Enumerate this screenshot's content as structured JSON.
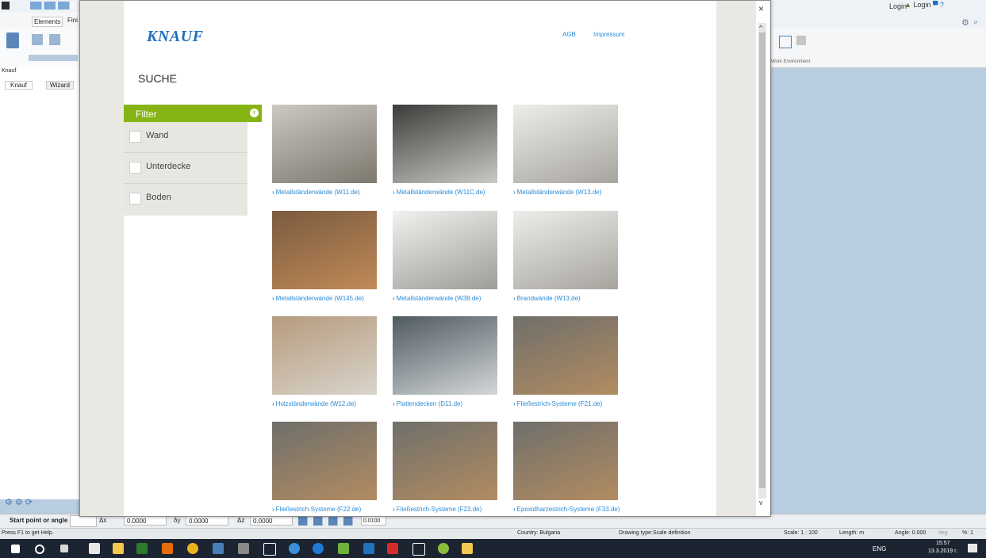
{
  "app": {
    "ribbon_tabs": [
      "Elements",
      "Fini"
    ],
    "left_panel_title": "Knauf",
    "left_tabs": [
      "Knauf",
      "Wizard"
    ],
    "right_top": {
      "login": "Login"
    },
    "right_ribbon_caption": "Work Environment",
    "cmd": {
      "prompt": "Start point or angle",
      "dx_label": "Δx",
      "dx": "0.0000",
      "dy_label": "δy",
      "dy": "0.0000",
      "dz_label": "Δz",
      "dz": "0.0000",
      "step": "0.0100"
    },
    "status": {
      "help": "Press F1 to get Help.",
      "country": "Country: Bulgaria",
      "drawing_type_label": "Drawing type:",
      "drawing_type": "Scale definition",
      "scale": "Scale: 1 : 100",
      "length": "Length: m",
      "angle": "Angle: 0.000",
      "angle_unit": "deg",
      "percent": "%: 1"
    },
    "taskbar": {
      "lang": "ENG",
      "time": "15:57",
      "date": "13.3.2019 г."
    }
  },
  "dialog": {
    "close_glyph": "×",
    "brand": "KNAUF",
    "links": {
      "agb": "AGB",
      "impressum": "Impressum"
    },
    "heading": "SUCHE",
    "filter": {
      "title": "Filter",
      "toggle_glyph": "‹",
      "options": [
        "Wand",
        "Unterdecke",
        "Boden"
      ]
    },
    "results": [
      {
        "label": "Metallständerwände (W11.de)",
        "colors": [
          "#cbc8c1",
          "#7d786e"
        ]
      },
      {
        "label": "Metallständerwände (W11C.de)",
        "colors": [
          "#3c3d3a",
          "#c9c9c6"
        ]
      },
      {
        "label": "Metallständerwände (W13.de)",
        "colors": [
          "#ededea",
          "#a7a49e"
        ]
      },
      {
        "label": "Metallständerwände (W145.de)",
        "colors": [
          "#7b5b3f",
          "#c08a58"
        ]
      },
      {
        "label": "Metallständerwände (W38.de)",
        "colors": [
          "#f1f1ef",
          "#9c9c98"
        ]
      },
      {
        "label": "Brandwände (W13.de)",
        "colors": [
          "#ededea",
          "#a7a49e"
        ]
      },
      {
        "label": "Holzständerwände (W12.de)",
        "colors": [
          "#b69b7e",
          "#d9d4cb"
        ]
      },
      {
        "label": "Plattendecken (D11.de)",
        "colors": [
          "#4f5a61",
          "#d3d7d9"
        ]
      },
      {
        "label": "Fließestrich-Systeme (F21.de)",
        "colors": [
          "#6f6f6b",
          "#b28c61"
        ]
      },
      {
        "label": "Fließestrich-Systeme (F22.de)",
        "colors": [
          "#6f6f6b",
          "#b28c61"
        ]
      },
      {
        "label": "Fließestrich-Systeme (F23.de)",
        "colors": [
          "#6f6f6b",
          "#b28c61"
        ]
      },
      {
        "label": "Epoxidharzestrich-Systeme (F33.de)",
        "colors": [
          "#6f6f6b",
          "#b28c61"
        ]
      }
    ]
  }
}
